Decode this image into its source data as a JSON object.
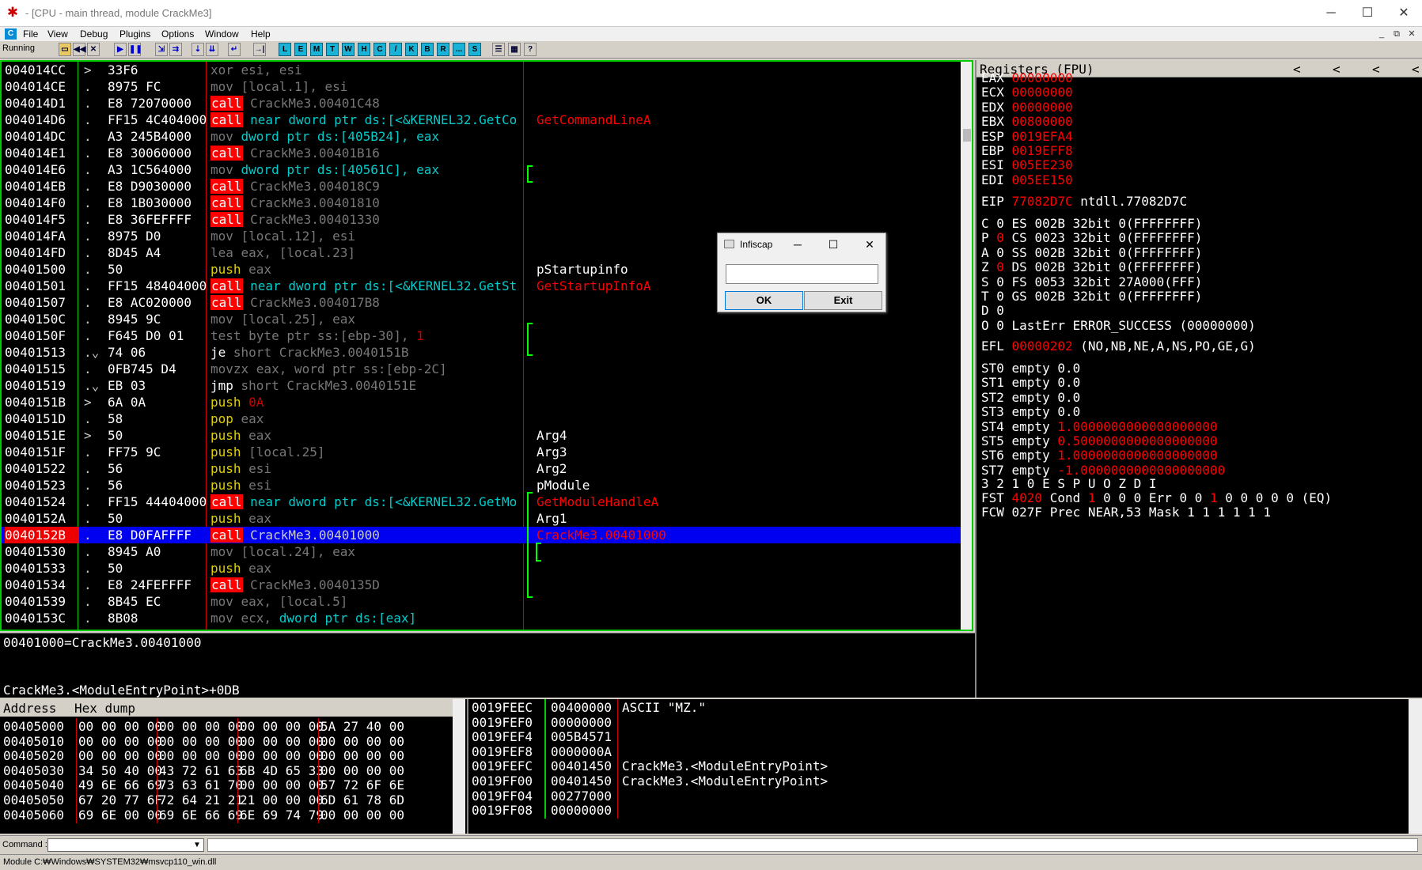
{
  "window": {
    "title": "- [CPU - main thread, module CrackMe3]",
    "min": "─",
    "max": "☐",
    "close": "✕"
  },
  "menu": {
    "icon": "C",
    "items": [
      "File",
      "View",
      "Debug",
      "Plugins",
      "Options",
      "Window",
      "Help"
    ],
    "mdi": [
      "_",
      "⧉",
      "✕"
    ]
  },
  "toolbar": {
    "status": "Running",
    "letters": [
      "L",
      "E",
      "M",
      "T",
      "W",
      "H",
      "C",
      "/",
      "K",
      "B",
      "R",
      "...",
      "S"
    ],
    "icons": [
      "open-icon",
      "rewind-icon",
      "close-icon",
      "run-icon",
      "pause-icon",
      "step-into-icon",
      "step-over-icon",
      "trace-into-icon",
      "trace-over-icon",
      "execute-till-return-icon",
      "goto-icon"
    ],
    "extra": [
      "list-icon",
      "grid-icon",
      "?"
    ]
  },
  "disasm": [
    {
      "addr": "004014CC",
      "mk": ">",
      "hex": "33F6",
      "dis": [
        [
          "g",
          "xor esi, esi"
        ]
      ]
    },
    {
      "addr": "004014CE",
      "mk": ".",
      "hex": "8975 FC",
      "dis": [
        [
          "g",
          "mov [local.1], esi"
        ]
      ]
    },
    {
      "addr": "004014D1",
      "mk": ".",
      "hex": "E8 72070000",
      "dis": [
        [
          "call",
          "call"
        ],
        [
          "g",
          " CrackMe3.00401C48"
        ]
      ]
    },
    {
      "addr": "004014D6",
      "mk": ".",
      "hex": "FF15 4C404000",
      "dis": [
        [
          "call",
          "call"
        ],
        [
          "c",
          " near dword ptr ds:[<&KERNEL32.GetCo"
        ]
      ],
      "cmt": [
        [
          "r",
          "GetCommandLineA"
        ]
      ]
    },
    {
      "addr": "004014DC",
      "mk": ".",
      "hex": "A3 245B4000",
      "dis": [
        [
          "g",
          "mov "
        ],
        [
          "c",
          "dword ptr ds:[405B24], eax"
        ]
      ]
    },
    {
      "addr": "004014E1",
      "mk": ".",
      "hex": "E8 30060000",
      "dis": [
        [
          "call",
          "call"
        ],
        [
          "g",
          " CrackMe3.00401B16"
        ]
      ]
    },
    {
      "addr": "004014E6",
      "mk": ".",
      "hex": "A3 1C564000",
      "dis": [
        [
          "g",
          "mov "
        ],
        [
          "c",
          "dword ptr ds:[40561C], eax"
        ]
      ]
    },
    {
      "addr": "004014EB",
      "mk": ".",
      "hex": "E8 D9030000",
      "dis": [
        [
          "call",
          "call"
        ],
        [
          "g",
          " CrackMe3.004018C9"
        ]
      ]
    },
    {
      "addr": "004014F0",
      "mk": ".",
      "hex": "E8 1B030000",
      "dis": [
        [
          "call",
          "call"
        ],
        [
          "g",
          " CrackMe3.00401810"
        ]
      ]
    },
    {
      "addr": "004014F5",
      "mk": ".",
      "hex": "E8 36FEFFFF",
      "dis": [
        [
          "call",
          "call"
        ],
        [
          "g",
          " CrackMe3.00401330"
        ]
      ]
    },
    {
      "addr": "004014FA",
      "mk": ".",
      "hex": "8975 D0",
      "dis": [
        [
          "g",
          "mov [local.12], esi"
        ]
      ]
    },
    {
      "addr": "004014FD",
      "mk": ".",
      "hex": "8D45 A4",
      "dis": [
        [
          "g",
          "lea eax, [local.23]"
        ]
      ]
    },
    {
      "addr": "00401500",
      "mk": ".",
      "hex": "50",
      "dis": [
        [
          "y",
          "push"
        ],
        [
          "g",
          " eax"
        ]
      ],
      "cmt": [
        [
          "w",
          "pStartupinfo"
        ]
      ]
    },
    {
      "addr": "00401501",
      "mk": ".",
      "hex": "FF15 48404000",
      "dis": [
        [
          "call",
          "call"
        ],
        [
          "c",
          " near dword ptr ds:[<&KERNEL32.GetSt"
        ]
      ],
      "cmt": [
        [
          "r",
          "GetStartupInfoA"
        ]
      ]
    },
    {
      "addr": "00401507",
      "mk": ".",
      "hex": "E8 AC020000",
      "dis": [
        [
          "call",
          "call"
        ],
        [
          "g",
          " CrackMe3.004017B8"
        ]
      ]
    },
    {
      "addr": "0040150C",
      "mk": ".",
      "hex": "8945 9C",
      "dis": [
        [
          "g",
          "mov [local.25], eax"
        ]
      ]
    },
    {
      "addr": "0040150F",
      "mk": ".",
      "hex": "F645 D0 01",
      "dis": [
        [
          "g",
          "test byte ptr ss:[ebp-30], "
        ],
        [
          "rd",
          "1"
        ]
      ]
    },
    {
      "addr": "00401513",
      "mk": ".⌄",
      "hex": "74 06",
      "dis": [
        [
          "w",
          "je "
        ],
        [
          "g",
          "short CrackMe3.0040151B"
        ]
      ]
    },
    {
      "addr": "00401515",
      "mk": ".",
      "hex": "0FB745 D4",
      "dis": [
        [
          "g",
          "movzx eax, word ptr ss:[ebp-2C]"
        ]
      ]
    },
    {
      "addr": "00401519",
      "mk": ".⌄",
      "hex": "EB 03",
      "dis": [
        [
          "w",
          "jmp "
        ],
        [
          "g",
          "short CrackMe3.0040151E"
        ]
      ]
    },
    {
      "addr": "0040151B",
      "mk": ">",
      "hex": "6A 0A",
      "dis": [
        [
          "y",
          "push"
        ],
        [
          "rd",
          " 0A"
        ]
      ]
    },
    {
      "addr": "0040151D",
      "mk": ".",
      "hex": "58",
      "dis": [
        [
          "y",
          "pop"
        ],
        [
          "g",
          " eax"
        ]
      ]
    },
    {
      "addr": "0040151E",
      "mk": ">",
      "hex": "50",
      "dis": [
        [
          "y",
          "push"
        ],
        [
          "g",
          " eax"
        ]
      ],
      "cmt": [
        [
          "w",
          "Arg4"
        ]
      ]
    },
    {
      "addr": "0040151F",
      "mk": ".",
      "hex": "FF75 9C",
      "dis": [
        [
          "y",
          "push"
        ],
        [
          "g",
          " [local.25]"
        ]
      ],
      "cmt": [
        [
          "w",
          "Arg3"
        ]
      ]
    },
    {
      "addr": "00401522",
      "mk": ".",
      "hex": "56",
      "dis": [
        [
          "y",
          "push"
        ],
        [
          "g",
          " esi"
        ]
      ],
      "cmt": [
        [
          "w",
          "Arg2"
        ]
      ]
    },
    {
      "addr": "00401523",
      "mk": ".",
      "hex": "56",
      "dis": [
        [
          "y",
          "push"
        ],
        [
          "g",
          " esi"
        ]
      ],
      "cmt": [
        [
          "w",
          " pModule"
        ]
      ]
    },
    {
      "addr": "00401524",
      "mk": ".",
      "hex": "FF15 44404000",
      "dis": [
        [
          "call",
          "call"
        ],
        [
          "c",
          " near dword ptr ds:[<&KERNEL32.GetMo"
        ]
      ],
      "cmt": [
        [
          "r",
          " GetModuleHandleA"
        ]
      ]
    },
    {
      "addr": "0040152A",
      "mk": ".",
      "hex": "50",
      "dis": [
        [
          "y",
          "push"
        ],
        [
          "g",
          " eax"
        ]
      ],
      "cmt": [
        [
          "w",
          "Arg1"
        ]
      ]
    },
    {
      "addr": "0040152B",
      "mk": ".",
      "hex": "E8 D0FAFFFF",
      "dis": [
        [
          "call",
          "call"
        ],
        [
          "g",
          " CrackMe3.00401000"
        ]
      ],
      "cmt": [
        [
          "r",
          "CrackMe3.00401000"
        ]
      ],
      "sel": true
    },
    {
      "addr": "00401530",
      "mk": ".",
      "hex": "8945 A0",
      "dis": [
        [
          "g",
          "mov [local.24], eax"
        ]
      ]
    },
    {
      "addr": "00401533",
      "mk": ".",
      "hex": "50",
      "dis": [
        [
          "y",
          "push"
        ],
        [
          "g",
          " eax"
        ]
      ]
    },
    {
      "addr": "00401534",
      "mk": ".",
      "hex": "E8 24FEFFFF",
      "dis": [
        [
          "call",
          "call"
        ],
        [
          "g",
          " CrackMe3.0040135D"
        ]
      ]
    },
    {
      "addr": "00401539",
      "mk": ".",
      "hex": "8B45 EC",
      "dis": [
        [
          "g",
          "mov eax, [local.5]"
        ]
      ]
    },
    {
      "addr": "0040153C",
      "mk": ".",
      "hex": "8B08",
      "dis": [
        [
          "g",
          "mov ecx, "
        ],
        [
          "c",
          "dword ptr ds:[eax]"
        ]
      ]
    }
  ],
  "info": {
    "line1": "00401000=CrackMe3.00401000",
    "line2": "CrackMe3.<ModuleEntryPoint>+0DB"
  },
  "registers": {
    "title": "Registers (FPU)",
    "arrows": [
      "<",
      "<",
      "<",
      "<"
    ],
    "gp": [
      [
        "EAX",
        "00000000"
      ],
      [
        "ECX",
        "00000000"
      ],
      [
        "EDX",
        "00000000"
      ],
      [
        "EBX",
        "00800000"
      ],
      [
        "ESP",
        "0019EFA4"
      ],
      [
        "EBP",
        "0019EFF8"
      ],
      [
        "ESI",
        "005EE230"
      ],
      [
        "EDI",
        "005EE150"
      ]
    ],
    "eip": {
      "name": "EIP",
      "value": "77082D7C",
      "sym": "ntdll.77082D7C"
    },
    "flags": [
      {
        "f": "C 0",
        "seg": "ES 002B 32bit 0(FFFFFFFF)"
      },
      {
        "f": "P ",
        "fv": "0",
        "seg": "CS 0023 32bit 0(FFFFFFFF)"
      },
      {
        "f": "A 0",
        "seg": "SS 002B 32bit 0(FFFFFFFF)"
      },
      {
        "f": "Z ",
        "fv": "0",
        "seg": "DS 002B 32bit 0(FFFFFFFF)"
      },
      {
        "f": "S 0",
        "seg": "FS 0053 32bit 27A000(FFF)"
      },
      {
        "f": "T 0",
        "seg": "GS 002B 32bit 0(FFFFFFFF)"
      },
      {
        "f": "D 0",
        "seg": ""
      },
      {
        "f": "O 0",
        "seg": "LastErr ERROR_SUCCESS (00000000)"
      }
    ],
    "efl": {
      "name": "EFL",
      "value": "00000202",
      "desc": "(NO,NB,NE,A,NS,PO,GE,G)"
    },
    "fpu": [
      [
        "ST0",
        "empty 0.0",
        ""
      ],
      [
        "ST1",
        "empty 0.0",
        ""
      ],
      [
        "ST2",
        "empty 0.0",
        ""
      ],
      [
        "ST3",
        "empty 0.0",
        ""
      ],
      [
        "ST4",
        "empty ",
        "1.0000000000000000000"
      ],
      [
        "ST5",
        "empty ",
        "0.5000000000000000000"
      ],
      [
        "ST6",
        "empty ",
        "1.0000000000000000000"
      ],
      [
        "ST7",
        "empty ",
        "-1.0000000000000000000"
      ]
    ],
    "fst_header": "3 2 1 0      E S P U O Z D I",
    "fst": {
      "name": "FST",
      "value": "4020",
      "a": "Cond ",
      "b": "1",
      "c": " 0 0 0  Err 0 0 ",
      "d": "1",
      "e": " 0 0 0 0 0  (EQ)"
    },
    "fcw": "FCW 027F  Prec NEAR,53  Mask    1 1 1 1 1 1"
  },
  "dump": {
    "h_addr": "Address",
    "h_hex": "Hex dump",
    "rows": [
      {
        "a": "00405000",
        "b": [
          "00 00 00 00",
          "00 00 00 00",
          "00 00 00 00",
          "5A 27 40 00"
        ]
      },
      {
        "a": "00405010",
        "b": [
          "00 00 00 00",
          "00 00 00 00",
          "00 00 00 00",
          "00 00 00 00"
        ]
      },
      {
        "a": "00405020",
        "b": [
          "00 00 00 00",
          "00 00 00 00",
          "00 00 00 00",
          "00 00 00 00"
        ]
      },
      {
        "a": "00405030",
        "b": [
          "34 50 40 00",
          "43 72 61 63",
          "6B 4D 65 33",
          "00 00 00 00"
        ]
      },
      {
        "a": "00405040",
        "b": [
          "49 6E 66 69",
          "73 63 61 70",
          "00 00 00 00",
          "57 72 6F 6E"
        ]
      },
      {
        "a": "00405050",
        "b": [
          "67 20 77 6F",
          "72 64 21 21",
          "21 00 00 00",
          "6D 61 78 6D"
        ]
      },
      {
        "a": "00405060",
        "b": [
          "69 6E 00 00",
          "69 6E 66 69",
          "6E 69 74 79",
          "00 00 00 00"
        ]
      }
    ]
  },
  "stack": [
    {
      "a": "0019FEEC",
      "v": "00400000",
      "c": "ASCII \"MZ.\"",
      "sel": true
    },
    {
      "a": "0019FEF0",
      "v": "00000000",
      "c": ""
    },
    {
      "a": "0019FEF4",
      "v": "005B4571",
      "c": ""
    },
    {
      "a": "0019FEF8",
      "v": "0000000A",
      "c": ""
    },
    {
      "a": "0019FEFC",
      "v": "00401450",
      "c": "CrackMe3.<ModuleEntryPoint>"
    },
    {
      "a": "0019FF00",
      "v": "00401450",
      "c": "CrackMe3.<ModuleEntryPoint>"
    },
    {
      "a": "0019FF04",
      "v": "00277000",
      "c": ""
    },
    {
      "a": "0019FF08",
      "v": "00000000",
      "c": ""
    }
  ],
  "command": {
    "label": "Command :",
    "arrow": "▼"
  },
  "statusbar": "Module C:₩Windows₩SYSTEM32₩msvcp110_win.dll",
  "dialog": {
    "title": "Infiscap",
    "ok": "OK",
    "exit": "Exit",
    "input_value": "",
    "min": "─",
    "max": "☐",
    "close": "✕"
  },
  "colors": {
    "green_border": "#00cc00",
    "selection": "#0000f0",
    "call_bg": "#ff0000"
  }
}
